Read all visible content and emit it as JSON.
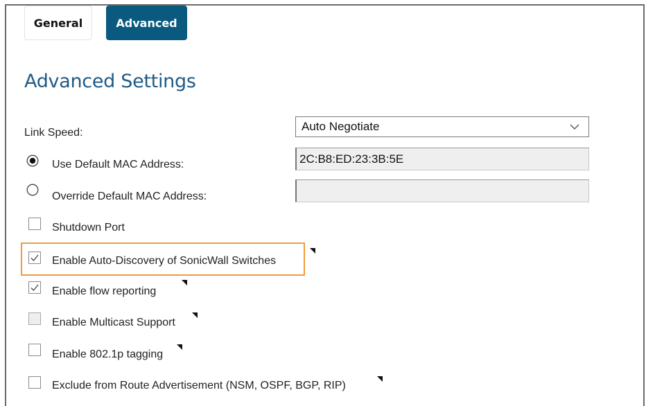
{
  "tabs": [
    {
      "label": "General",
      "active": false
    },
    {
      "label": "Advanced",
      "active": true
    }
  ],
  "section_title": "Advanced Settings",
  "link_speed": {
    "label": "Link Speed:",
    "value": "Auto Negotiate"
  },
  "mac": {
    "use_default_label": "Use Default MAC Address:",
    "use_default_selected": true,
    "default_value": "2C:B8:ED:23:3B:5E",
    "override_label": "Override Default MAC Address:",
    "override_selected": false,
    "override_value": ""
  },
  "options": [
    {
      "label": "Shutdown Port",
      "checked": false,
      "disabled": false
    },
    {
      "label": "Enable Auto-Discovery of SonicWall Switches",
      "checked": true,
      "disabled": false,
      "highlighted": true
    },
    {
      "label": "Enable flow reporting",
      "checked": true,
      "disabled": false
    },
    {
      "label": "Enable Multicast Support",
      "checked": false,
      "disabled": true
    },
    {
      "label": "Enable 802.1p tagging",
      "checked": false,
      "disabled": false
    },
    {
      "label": "Exclude from Route Advertisement (NSM, OSPF, BGP, RIP)",
      "checked": false,
      "disabled": false
    }
  ],
  "colors": {
    "tab_active": "#0a5a80",
    "title": "#1f5b86",
    "highlight": "#f39a3a"
  }
}
